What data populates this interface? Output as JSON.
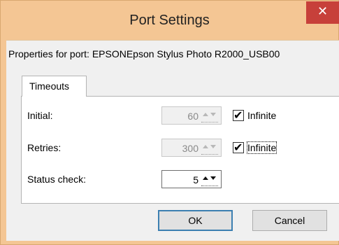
{
  "window": {
    "title": "Port Settings",
    "close_glyph": "✕"
  },
  "properties_label": "Properties for port: EPSONEpson Stylus Photo R2000_USB00",
  "tab": {
    "label": "Timeouts"
  },
  "rows": [
    {
      "label": "Initial:",
      "value": "60",
      "enabled": false,
      "infinite_checked": true,
      "infinite_label": "Infinite"
    },
    {
      "label": "Retries:",
      "value": "300",
      "enabled": false,
      "infinite_checked": true,
      "infinite_label": "Infinite"
    },
    {
      "label": "Status check:",
      "value": "5",
      "enabled": true
    }
  ],
  "check_glyph": "✔",
  "buttons": {
    "ok": "OK",
    "cancel": "Cancel"
  },
  "icons": {
    "close": "close-icon",
    "spin_up": "chevron-up-icon",
    "spin_down": "chevron-down-icon",
    "check": "checkmark-icon"
  },
  "colors": {
    "frame": "#f4c694",
    "close_button": "#c7403a",
    "dialog_bg": "#f0f0f0",
    "default_button_border": "#3c7fb1"
  }
}
